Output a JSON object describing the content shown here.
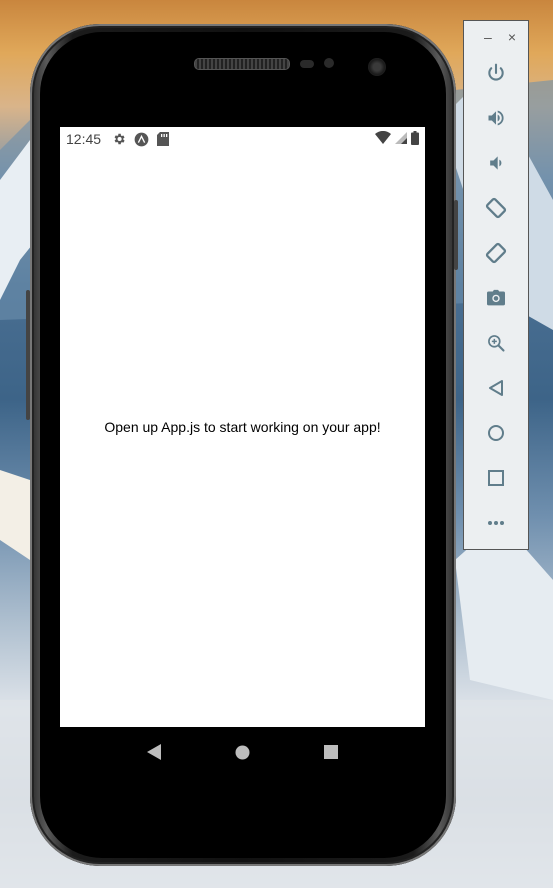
{
  "status_bar": {
    "time": "12:45",
    "left_icons": [
      "gear-icon",
      "expo-logo-icon",
      "sd-card-icon"
    ],
    "right_icons": [
      "wifi-icon",
      "cell-signal-icon",
      "battery-icon"
    ]
  },
  "app": {
    "message": "Open up App.js to start working on your app!"
  },
  "nav_bar": {
    "buttons": [
      "back-icon",
      "home-icon",
      "recents-icon"
    ]
  },
  "toolbar": {
    "window_controls": {
      "minimize": "–",
      "close": "×"
    },
    "buttons": [
      "power-icon",
      "volume-up-icon",
      "volume-down-icon",
      "rotate-left-icon",
      "rotate-right-icon",
      "camera-icon",
      "zoom-icon",
      "back-icon",
      "home-icon",
      "overview-icon",
      "more-icon"
    ],
    "icon_color": "#607d8b"
  }
}
